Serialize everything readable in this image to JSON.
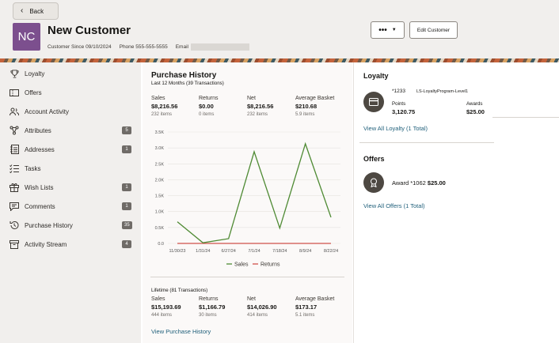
{
  "header": {
    "back_label": "Back",
    "avatar_initials": "NC",
    "customer_name": "New Customer",
    "customer_since_label": "Customer Since",
    "customer_since_value": "09/10/2024",
    "phone_label": "Phone",
    "phone_value": "555-555-5555",
    "email_label": "Email",
    "more_label": "•••",
    "edit_label": "Edit Customer"
  },
  "sidebar": {
    "items": [
      {
        "label": "Loyalty",
        "icon": "trophy-icon",
        "badge": ""
      },
      {
        "label": "Offers",
        "icon": "ticket-icon",
        "badge": ""
      },
      {
        "label": "Account Activity",
        "icon": "people-icon",
        "badge": ""
      },
      {
        "label": "Attributes",
        "icon": "network-icon",
        "badge": "5"
      },
      {
        "label": "Addresses",
        "icon": "address-book-icon",
        "badge": "1"
      },
      {
        "label": "Tasks",
        "icon": "checklist-icon",
        "badge": ""
      },
      {
        "label": "Wish Lists",
        "icon": "gift-icon",
        "badge": "1"
      },
      {
        "label": "Comments",
        "icon": "comment-icon",
        "badge": "1"
      },
      {
        "label": "Purchase History",
        "icon": "history-icon",
        "badge": "35"
      },
      {
        "label": "Activity Stream",
        "icon": "archive-icon",
        "badge": "4"
      }
    ]
  },
  "purchase_history": {
    "title": "Purchase History",
    "subtitle": "Last 12 Months (39 Transactions)",
    "stats": [
      {
        "label": "Sales",
        "value": "$8,216.56",
        "sub": "232 items"
      },
      {
        "label": "Returns",
        "value": "$0.00",
        "sub": "0 items"
      },
      {
        "label": "Net",
        "value": "$8,216.56",
        "sub": "232 items"
      },
      {
        "label": "Average Basket",
        "value": "$210.68",
        "sub": "5.9 items"
      }
    ],
    "lifetime_title": "Lifetime (81 Transactions)",
    "lifetime_stats": [
      {
        "label": "Sales",
        "value": "$15,193.69",
        "sub": "444 items"
      },
      {
        "label": "Returns",
        "value": "$1,166.79",
        "sub": "30 items"
      },
      {
        "label": "Net",
        "value": "$14,026.90",
        "sub": "414 items"
      },
      {
        "label": "Average Basket",
        "value": "$173.17",
        "sub": "5.1 items"
      }
    ],
    "view_link": "View Purchase History"
  },
  "chart_data": {
    "type": "line",
    "x": [
      "11/30/23",
      "1/31/24",
      "6/27/24",
      "7/1/24",
      "7/18/24",
      "8/9/24",
      "8/22/24"
    ],
    "y_ticks": [
      "0.0",
      "0.5K",
      "1.0K",
      "1.5K",
      "2.0K",
      "2.5K",
      "3.0K",
      "3.5K"
    ],
    "ylim": [
      0,
      3500
    ],
    "grid": true,
    "legend_position": "bottom",
    "series": [
      {
        "name": "Sales",
        "color": "#4e8a33",
        "values": [
          680,
          20,
          150,
          2880,
          480,
          3130,
          820
        ]
      },
      {
        "name": "Returns",
        "color": "#d0524a",
        "values": [
          0,
          0,
          0,
          0,
          0,
          0,
          0
        ]
      }
    ]
  },
  "loyalty": {
    "title": "Loyalty",
    "card_number": "*1233",
    "program": "LS-LoyaltyProgram-Level1",
    "points_label": "Points",
    "points_value": "3,120.75",
    "awards_label": "Awards",
    "awards_value": "$25.00",
    "view_link": "View All Loyalty (1 Total)"
  },
  "offers": {
    "title": "Offers",
    "offer_text": "Award *1062",
    "offer_value": "$25.00",
    "view_link": "View All Offers (1 Total)"
  }
}
